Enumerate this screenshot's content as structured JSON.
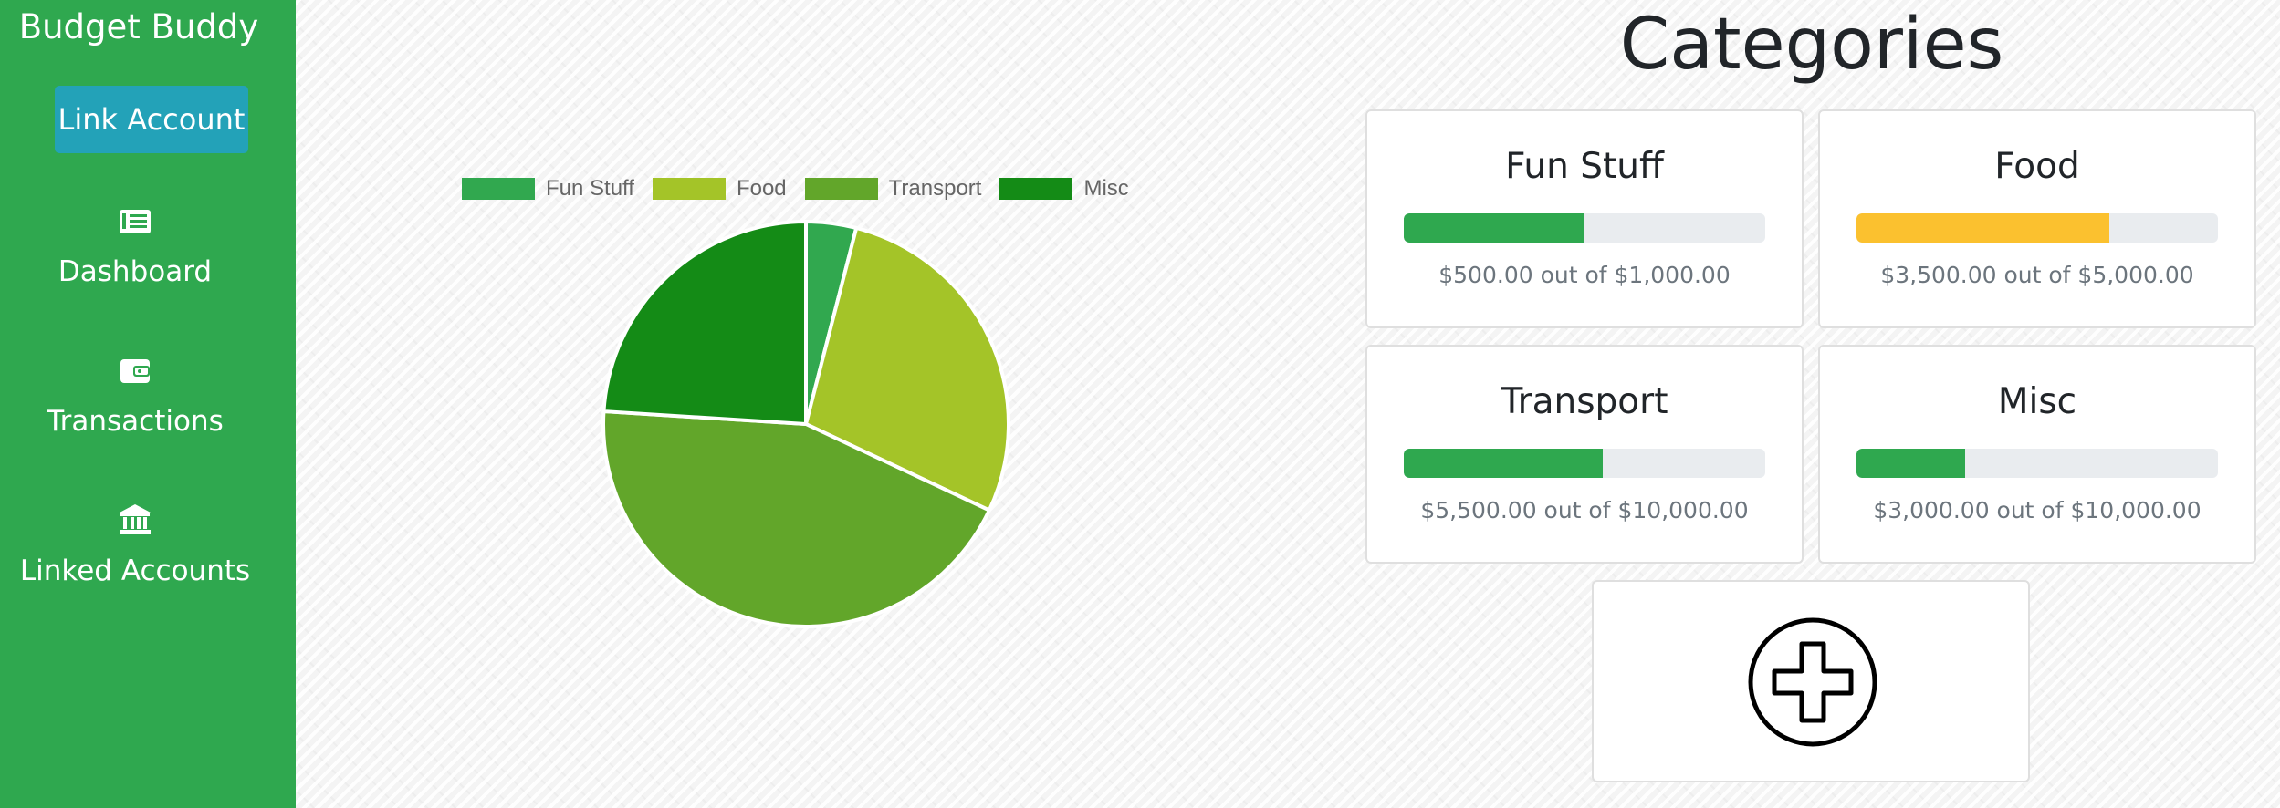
{
  "sidebar": {
    "brand": "Budget Buddy",
    "link_account_label": "Link Account",
    "nav": [
      {
        "label": "Dashboard",
        "icon": "newspaper-icon"
      },
      {
        "label": "Transactions",
        "icon": "wallet-icon"
      },
      {
        "label": "Linked Accounts",
        "icon": "bank-icon"
      }
    ],
    "background_color": "#2fa84f",
    "button_color": "#23a2b8"
  },
  "page": {
    "title": "Categories"
  },
  "chart_data": {
    "type": "pie",
    "legend_position": "top",
    "categories": [
      "Fun Stuff",
      "Food",
      "Transport",
      "Misc"
    ],
    "values": [
      500,
      3500,
      5500,
      3000
    ],
    "colors": [
      "#31a84f",
      "#a4c428",
      "#62a62a",
      "#148b16"
    ]
  },
  "categories": [
    {
      "name": "Fun Stuff",
      "amount_text": "$500.00 out of $1,000.00",
      "spent": 500,
      "budget": 1000,
      "bar_color": "#2fa84f"
    },
    {
      "name": "Food",
      "amount_text": "$3,500.00 out of $5,000.00",
      "spent": 3500,
      "budget": 5000,
      "bar_color": "#fbc12f"
    },
    {
      "name": "Transport",
      "amount_text": "$5,500.00 out of $10,000.00",
      "spent": 5500,
      "budget": 10000,
      "bar_color": "#2fa84f"
    },
    {
      "name": "Misc",
      "amount_text": "$3,000.00 out of $10,000.00",
      "spent": 3000,
      "budget": 10000,
      "bar_color": "#2fa84f"
    }
  ],
  "add_category": {
    "icon": "plus-circle-icon"
  }
}
